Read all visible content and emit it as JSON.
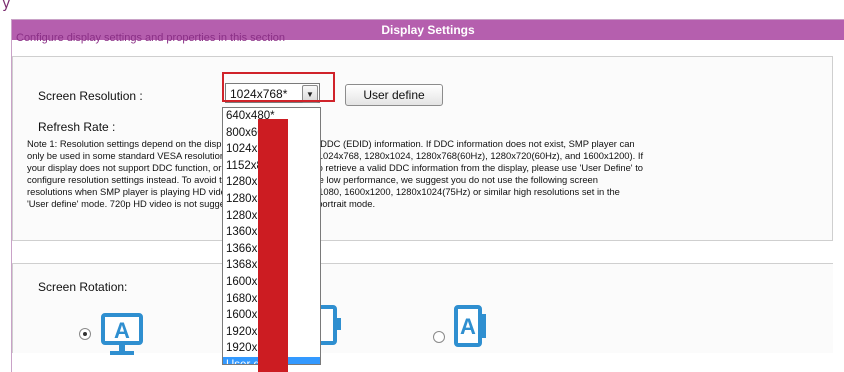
{
  "corner_glyph": "y",
  "header": {
    "title": "Display Settings"
  },
  "intro": "Configure display settings and properties in this section",
  "resolution": {
    "label": "Screen Resolution :",
    "selected": "1024x768*",
    "user_define_button": "User define",
    "options": [
      "640x480*",
      "800x600",
      "1024x768*",
      "1152x864",
      "1280x768*",
      "1280x800",
      "1280x1024",
      "1360x768",
      "1366x768*",
      "1368x768",
      "1600x900",
      "1680x1050",
      "1600x1200",
      "1920x1080",
      "1920x1200",
      "User define"
    ],
    "highlighted_option": "User define",
    "colors": {
      "highlight_border": "#d0232a",
      "overlay_bar": "#cc1c22",
      "selection": "#3399ff"
    }
  },
  "refresh": {
    "label": "Refresh Rate :"
  },
  "note": {
    "lines": [
      "Note 1: Resolution settings depend on the display device and device's DDC (EDID) information. If DDC information does not exist, SMP player can",
      "only be used in some standard VESA resolutions (640x480, 800x600, 1024x768, 1280x1024, 1280x768(60Hz), 1280x720(60Hz), and 1600x1200). If",
      "your display does not support DDC function, or SMP player is unable to retrieve a valid DDC information from the display, please use 'User Define' to",
      "configure resolution settings instead. To avoid the system running in the low performance, we suggest you do not use the following screen",
      "resolutions when SMP player is playing HD videos: 1920x1200, 1920x1080, 1600x1200, 1280x1024(75Hz) or similar high resolutions set in the",
      "'User define' mode. 720p HD video is not suggested to be used in the portrait mode."
    ]
  },
  "rotation": {
    "label": "Screen Rotation:",
    "options": [
      {
        "icon": "monitor-landscape-icon",
        "checked": true
      },
      {
        "icon": "monitor-rotated-icon",
        "checked": false
      },
      {
        "icon": "monitor-portrait-icon",
        "checked": false
      }
    ]
  },
  "colors": {
    "header_bg": "#b55fae",
    "intro_text": "#8a2f86",
    "icon_blue": "#2f8fd0"
  }
}
